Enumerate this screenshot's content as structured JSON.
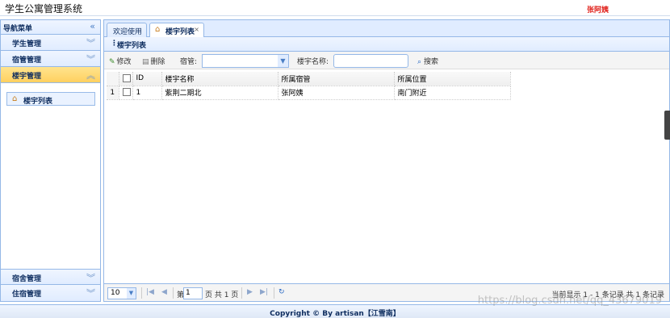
{
  "header": {
    "title": "学生公寓管理系统",
    "user": "张阿姨"
  },
  "sidebar": {
    "title": "导航菜单",
    "groups": [
      {
        "label": "学生管理"
      },
      {
        "label": "宿管管理"
      },
      {
        "label": "楼宇管理"
      },
      {
        "label": "宿舍管理"
      },
      {
        "label": "住宿管理"
      }
    ],
    "active_item": "楼宇列表"
  },
  "tabs": [
    {
      "label": "欢迎使用"
    },
    {
      "label": "楼宇列表"
    }
  ],
  "panel": {
    "title": "楼宇列表"
  },
  "toolbar": {
    "edit": "修改",
    "delete": "删除",
    "manager_label": "宿管:",
    "name_label": "楼宇名称:",
    "search": "搜索"
  },
  "grid": {
    "columns": [
      "ID",
      "楼宇名称",
      "所属宿管",
      "所属位置"
    ],
    "rows": [
      {
        "num": "1",
        "cells": [
          "1",
          "紫荆二期北",
          "张阿姨",
          "南门附近"
        ]
      }
    ]
  },
  "pager": {
    "page_size": "10",
    "page_prefix": "第",
    "page": "1",
    "page_suffix": "页 共 1 页",
    "info": "当前显示 1 - 1 条记录 共 1 条记录"
  },
  "footer": {
    "text": "Copyright © By artisan【江雪南】"
  },
  "watermark": "https://blog.csdn.net/qq_43679019",
  "colors": {
    "border": "#95b8e7",
    "accent_active": "#ffd060",
    "user": "#e0201a"
  }
}
